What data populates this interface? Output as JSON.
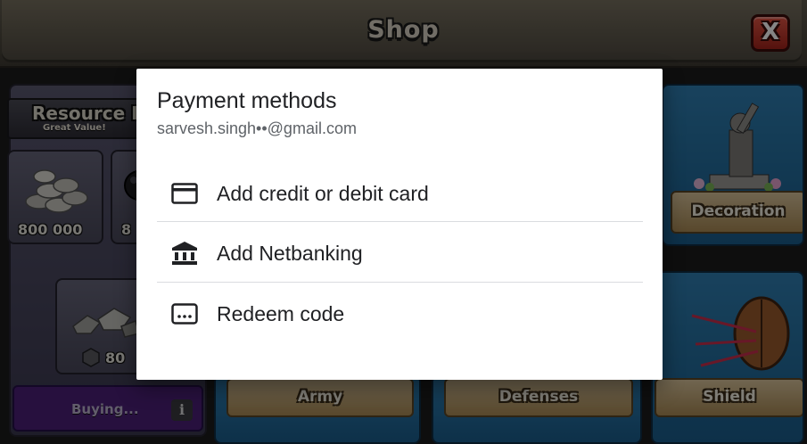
{
  "game": {
    "header_title": "Shop",
    "close_label": "X",
    "resource_panel": {
      "title": "Resource I",
      "subtitle": "Great Value!",
      "tiles": [
        {
          "label": "800 000"
        },
        {
          "label": "8"
        }
      ],
      "gem_tile": {
        "label": "80"
      },
      "buy_label": "Buying...",
      "info_label": "i"
    },
    "categories": [
      {
        "label": "Decoration"
      },
      {
        "label": "Army"
      },
      {
        "label": "Defenses"
      },
      {
        "label": "Shield"
      }
    ]
  },
  "dialog": {
    "title": "Payment methods",
    "email": "sarvesh.singh••@gmail.com",
    "options": [
      {
        "label": "Add credit or debit card",
        "icon": "credit-card-icon"
      },
      {
        "label": "Add Netbanking",
        "icon": "bank-icon"
      },
      {
        "label": "Redeem code",
        "icon": "redeem-code-icon"
      }
    ]
  },
  "colors": {
    "scrim": "#000000",
    "dialog_bg": "#ffffff",
    "text_primary": "#202124",
    "text_secondary": "#5f6368",
    "divider": "#dadce0",
    "close_button": "#c23a2e",
    "buy_bar": "#4c1f77"
  }
}
